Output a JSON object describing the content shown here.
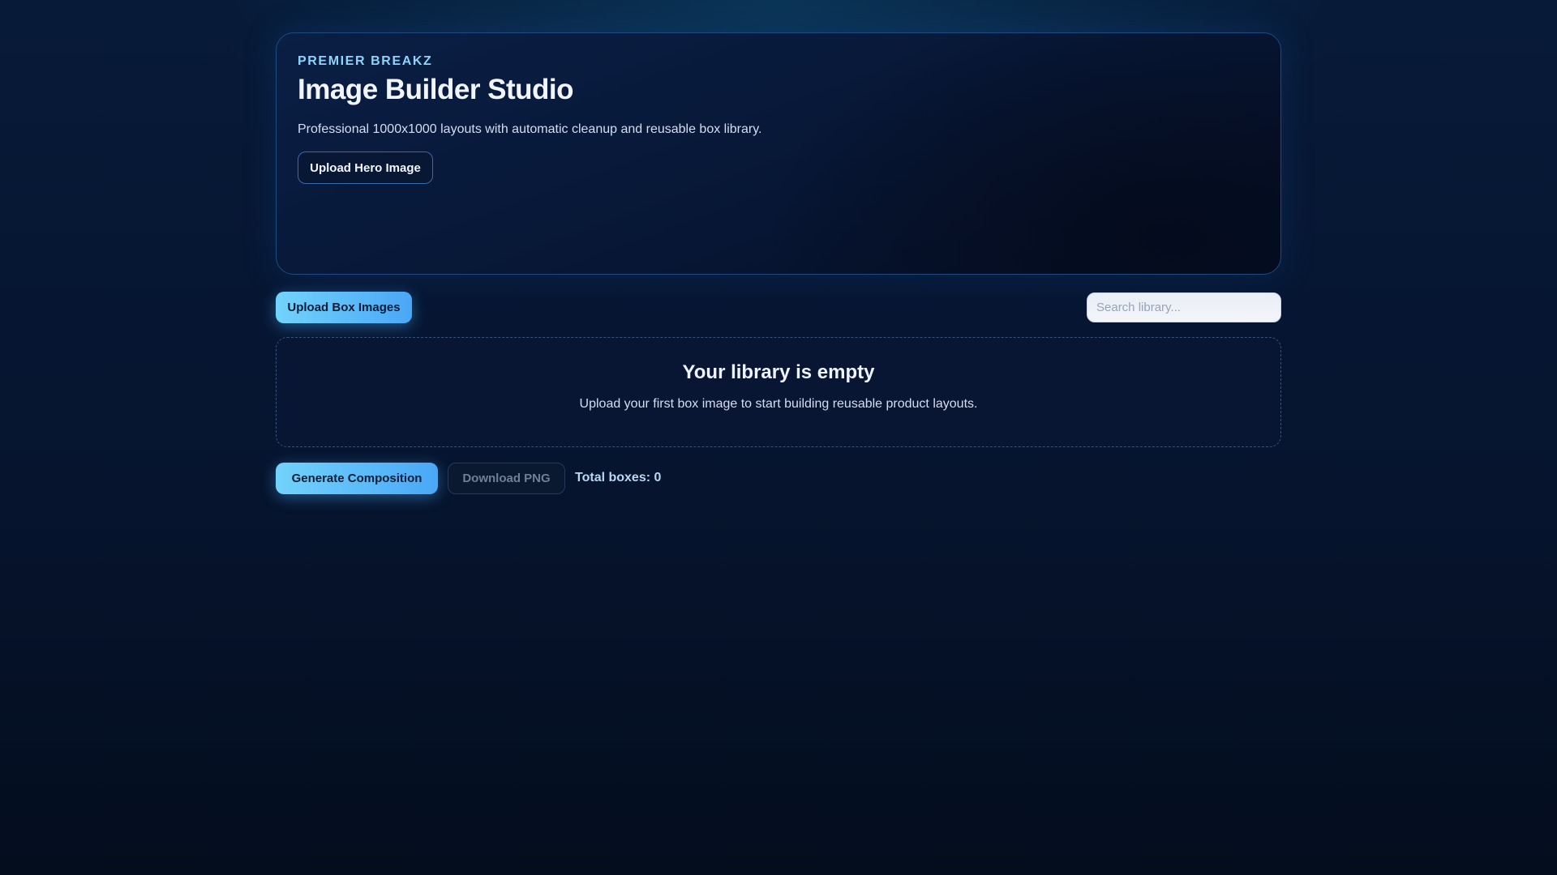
{
  "hero": {
    "brand": "PREMIER BREAKZ",
    "title": "Image Builder Studio",
    "subtitle": "Professional 1000x1000 layouts with automatic cleanup and reusable box library.",
    "upload_hero_label": "Upload Hero Image"
  },
  "library": {
    "upload_label": "Upload Box Images",
    "search_placeholder": "Search library...",
    "empty_title": "Your library is empty",
    "empty_text": "Upload your first box image to start building reusable product layouts."
  },
  "actions": {
    "generate_label": "Generate Composition",
    "download_label": "Download PNG",
    "total_label": "Total boxes: 0"
  },
  "colors": {
    "accent": "#4aa7f6",
    "brand": "#8fd3fb"
  }
}
